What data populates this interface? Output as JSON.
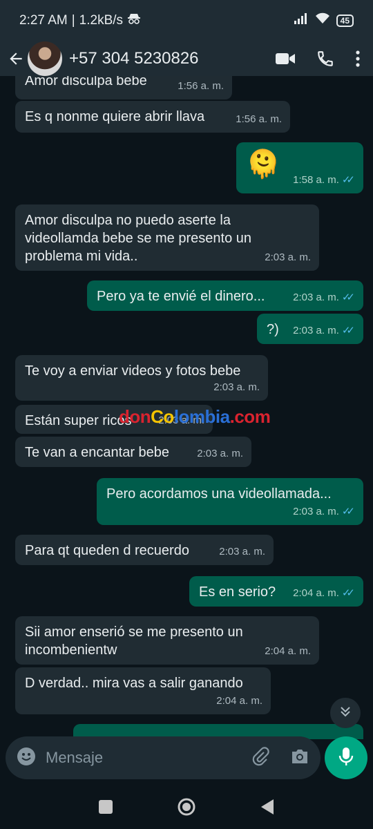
{
  "status": {
    "time": "2:27 AM",
    "separator": "|",
    "speed": "1.2kB/s",
    "battery": "45"
  },
  "header": {
    "contact": "+57 304 5230826"
  },
  "messages": [
    {
      "dir": "in",
      "text": "Amor disculpa bebe",
      "time": "1:56 a. m."
    },
    {
      "dir": "in",
      "text": "Es q nonme quiere abrir llava",
      "time": "1:56 a. m."
    },
    {
      "dir": "out",
      "text": "🫠",
      "time": "1:58 a. m."
    },
    {
      "dir": "in",
      "text": "Amor disculpa no puedo aserte la videollamda bebe se me presento un problema mi vida..",
      "time": "2:03 a. m."
    },
    {
      "dir": "out",
      "text": "Pero ya te envié el dinero...",
      "time": "2:03 a. m."
    },
    {
      "dir": "out",
      "text": "?)",
      "time": "2:03 a. m."
    },
    {
      "dir": "in",
      "text": "Te voy a enviar videos y fotos bebe",
      "time": "2:03 a. m."
    },
    {
      "dir": "in",
      "text": "Están super ricos",
      "time": "2:03 a. m."
    },
    {
      "dir": "in",
      "text": "Te van a encantar bebe",
      "time": "2:03 a. m."
    },
    {
      "dir": "out",
      "text": "Pero acordamos una videollamada...",
      "time": "2:03 a. m."
    },
    {
      "dir": "in",
      "text": "Para qt queden d recuerdo",
      "time": "2:03 a. m."
    },
    {
      "dir": "out",
      "text": "Es en serio?",
      "time": "2:04 a. m."
    },
    {
      "dir": "in",
      "text": "Sii amor enserió se me presento un incombenientw",
      "time": "2:04 a. m."
    },
    {
      "dir": "in",
      "text": "D verdad.. mira vas a salir ganando",
      "time": "2:04 a. m."
    }
  ],
  "watermark": {
    "p1": "don",
    "p2": "Co",
    "p3": "lombia",
    "p4": ".com"
  },
  "input": {
    "placeholder": "Mensaje"
  },
  "colors": {
    "incoming_bubble": "#202c33",
    "outgoing_bubble": "#005c4b",
    "accent": "#00a884",
    "read_ticks": "#53bdeb"
  }
}
